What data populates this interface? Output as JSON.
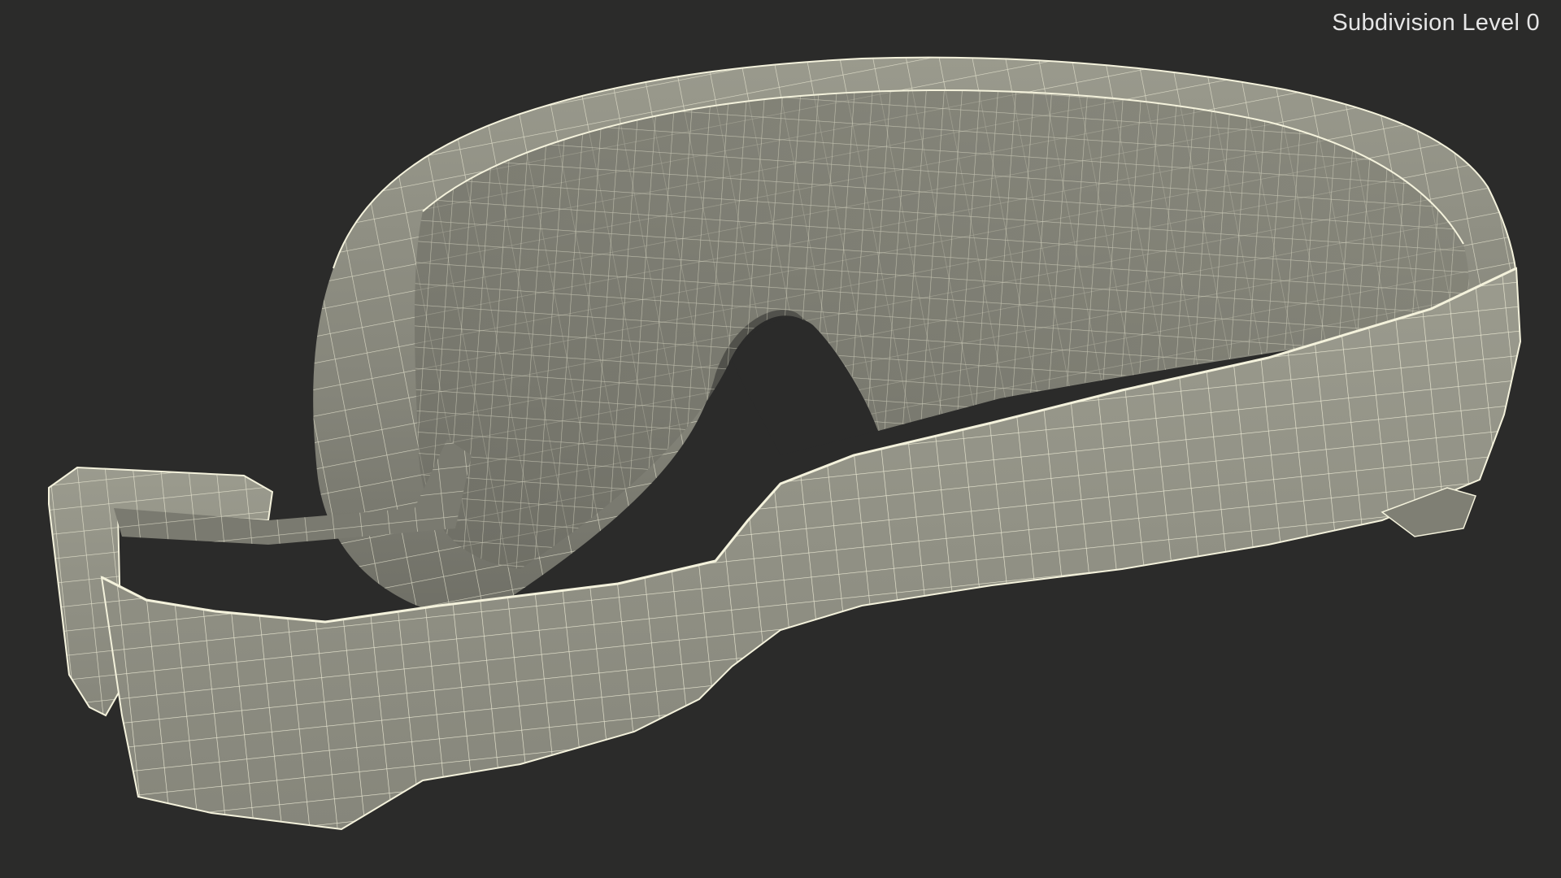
{
  "viewport": {
    "subdivision_label": "Subdivision Level 0"
  },
  "model": {
    "icon": "sleep-mask-wireframe",
    "surface_color": "#8e8e81",
    "shadow_color": "#6b6b61",
    "wire_color": "#f4f2dc",
    "background_color": "#2b2b2a"
  }
}
